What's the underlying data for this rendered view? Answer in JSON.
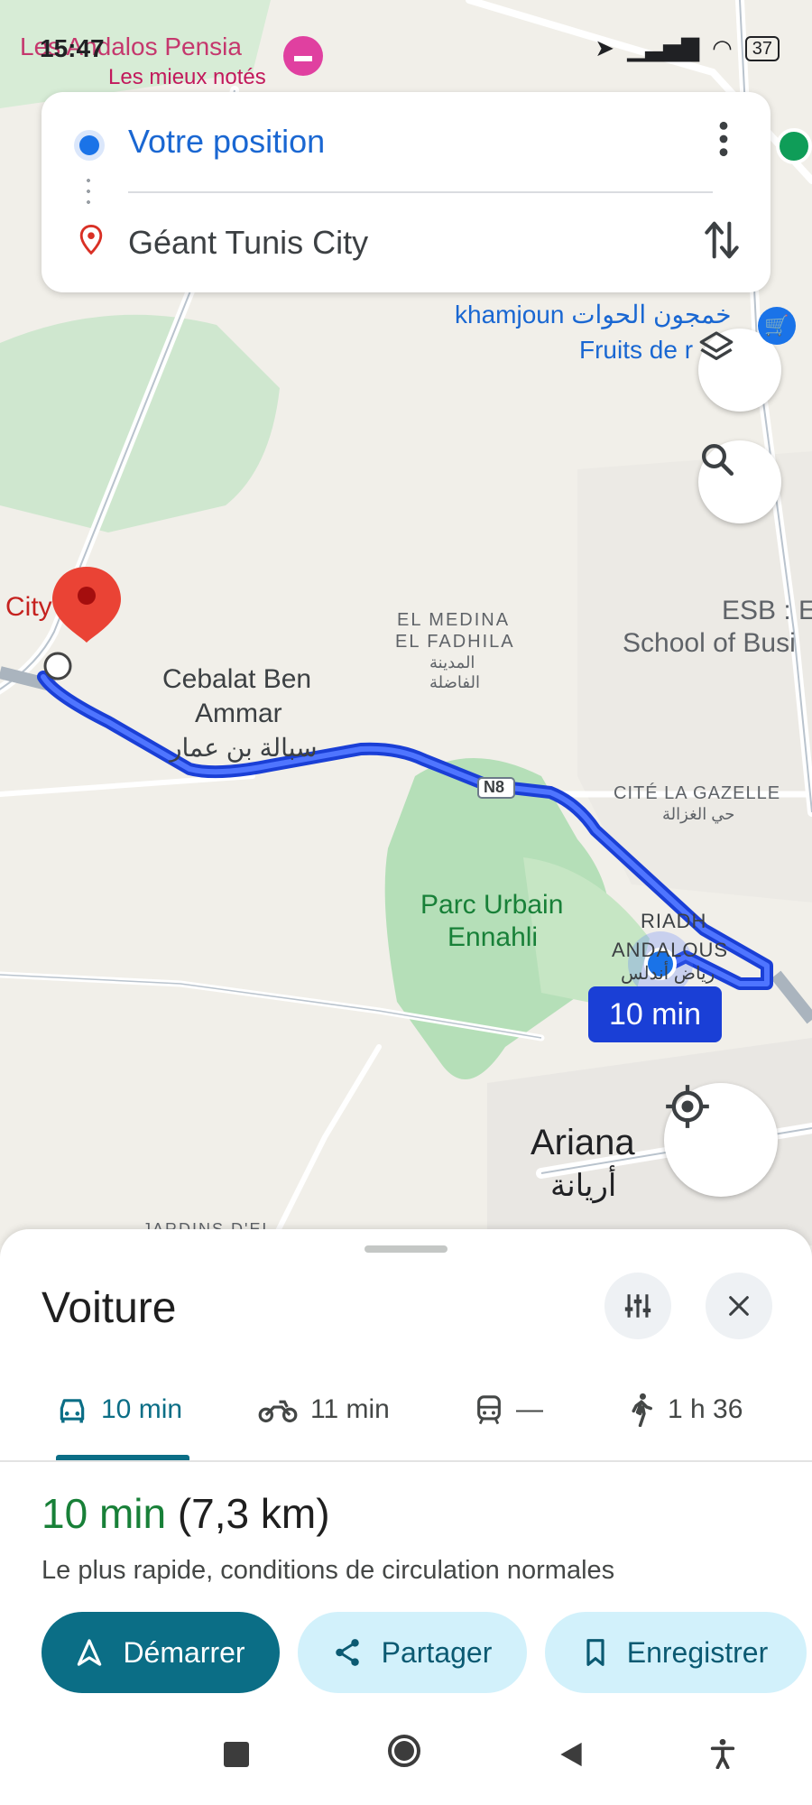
{
  "status_bar": {
    "time": "15:47",
    "overlay_text": "Les Andalos Pensia",
    "sub_text": "Les mieux notés",
    "battery": "37"
  },
  "search": {
    "origin": "Votre position",
    "destination": "Géant Tunis City"
  },
  "map_labels": {
    "dest_label": "City",
    "khamjoun": "khamjoun خمجون الحوات",
    "fruits": "Fruits de r",
    "esb1": "ESB : E",
    "esb2": "School of Busi",
    "medina1": "EL MEDINA",
    "medina2": "EL FADHILA",
    "medina_ar1": "المدينة",
    "medina_ar2": "الفاضلة",
    "cebalat1": "Cebalat Ben",
    "cebalat2": "Ammar",
    "cebalat_ar": "سبالة بن عمار",
    "n8": "N8",
    "gazelle": "CITÉ LA GAZELLE",
    "gazelle_ar": "حي الغزالة",
    "parc1": "Parc Urbain",
    "parc2": "Ennahli",
    "riadh1": "RIADH",
    "riadh2": "ANDALOUS",
    "riadh_ar": "رياض أندلس",
    "ariana": "Ariana",
    "ariana_ar": "أريانة",
    "jardins": "JARDINS D'EL",
    "eta": "10 min"
  },
  "sheet": {
    "title": "Voiture",
    "modes": [
      {
        "icon": "car-icon",
        "label": "10 min"
      },
      {
        "icon": "motorcycle-icon",
        "label": "11 min"
      },
      {
        "icon": "transit-icon",
        "label": "—"
      },
      {
        "icon": "walk-icon",
        "label": "1 h 36"
      }
    ],
    "duration": "10 min",
    "distance": "(7,3 km)",
    "description": "Le plus rapide, conditions de circulation normales",
    "buttons": {
      "start": "Démarrer",
      "share": "Partager",
      "save": "Enregistrer"
    }
  },
  "colors": {
    "route": "#1a3fd6",
    "accent": "#0b6e86",
    "park": "#b5dfb8"
  }
}
